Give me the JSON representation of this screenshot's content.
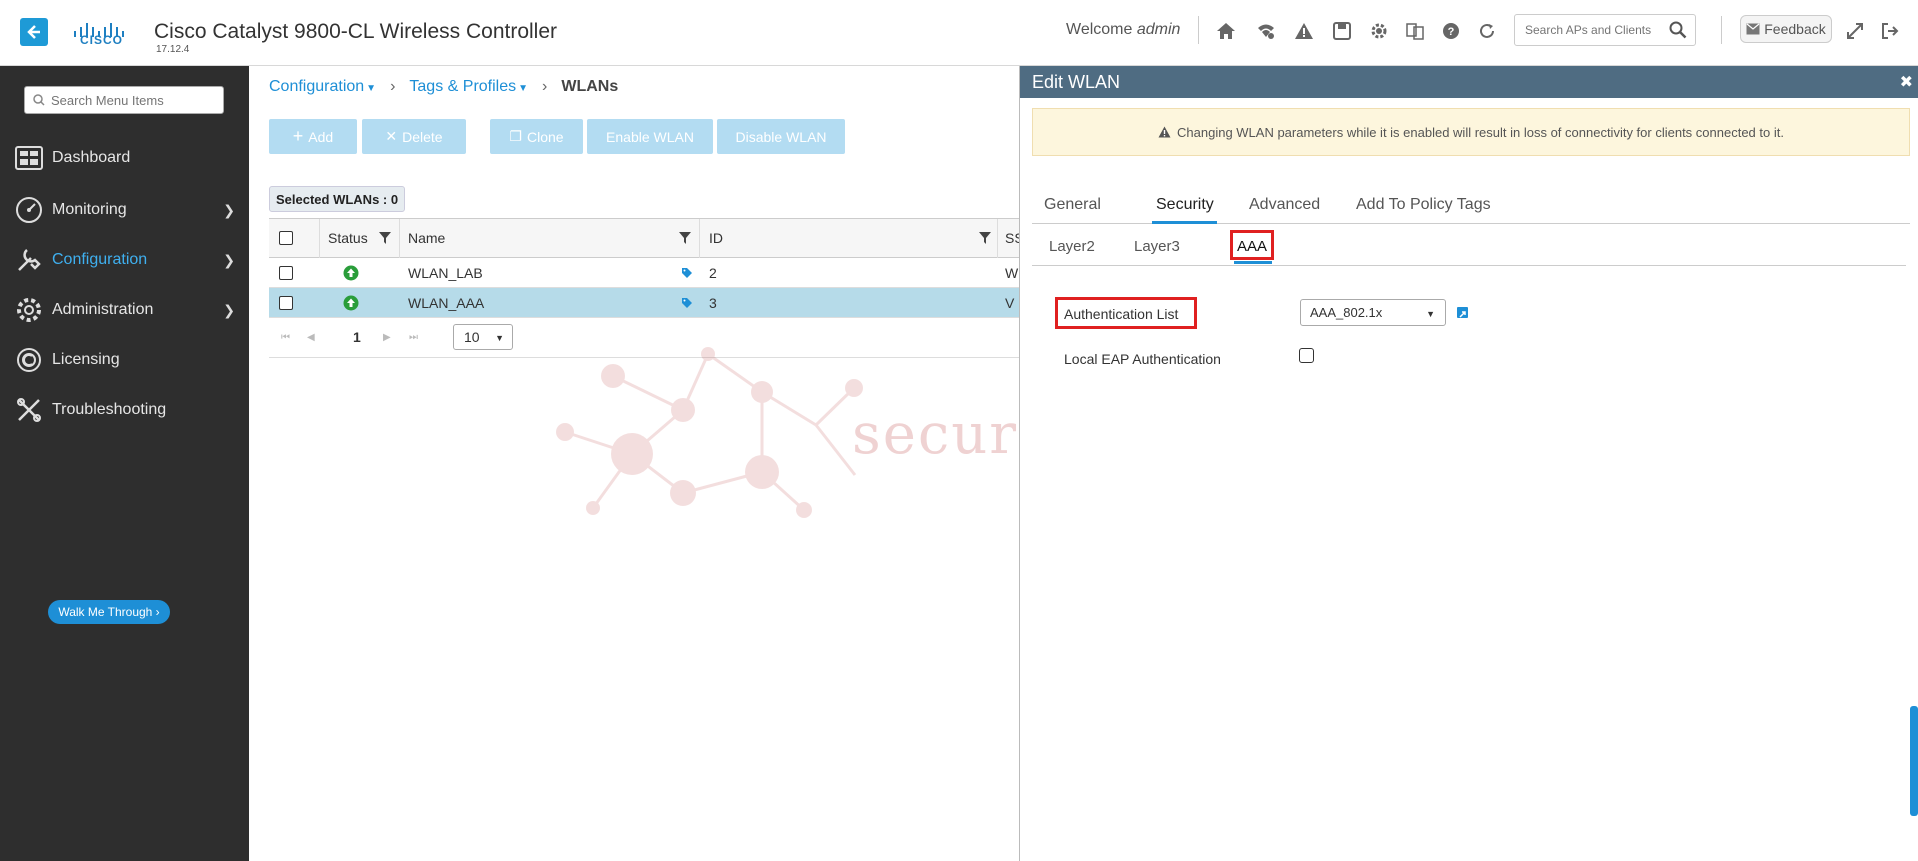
{
  "header": {
    "brand": "CISCO",
    "title": "Cisco Catalyst 9800-CL Wireless Controller",
    "version": "17.12.4",
    "welcome": "Welcome",
    "user": "admin",
    "search_placeholder": "Search APs and Clients",
    "feedback_label": "Feedback"
  },
  "sidebar": {
    "search_placeholder": "Search Menu Items",
    "items": [
      {
        "label": "Dashboard",
        "icon": "dashboard-icon"
      },
      {
        "label": "Monitoring",
        "icon": "monitoring-icon"
      },
      {
        "label": "Configuration",
        "icon": "configuration-icon"
      },
      {
        "label": "Administration",
        "icon": "administration-icon"
      },
      {
        "label": "Licensing",
        "icon": "licensing-icon"
      },
      {
        "label": "Troubleshooting",
        "icon": "troubleshooting-icon"
      }
    ],
    "active": "Configuration",
    "walk_me_label": "Walk Me Through ›"
  },
  "breadcrumb": {
    "level1": "Configuration",
    "level2": "Tags & Profiles",
    "current": "WLANs"
  },
  "toolbar": {
    "add": "Add",
    "delete": "Delete",
    "clone": "Clone",
    "enable": "Enable WLAN",
    "disable": "Disable WLAN"
  },
  "selected_label": "Selected WLANs : 0",
  "grid": {
    "columns": [
      "Status",
      "Name",
      "ID",
      "SS"
    ],
    "rows": [
      {
        "name": "WLAN_LAB",
        "id": "2",
        "ss": "W",
        "selected": false
      },
      {
        "name": "WLAN_AAA",
        "id": "3",
        "ss": "V",
        "selected": true
      }
    ],
    "page": "1",
    "page_size": "10"
  },
  "watermark": "securityzone.vn",
  "edit_panel": {
    "title": "Edit WLAN",
    "warning": "Changing WLAN parameters while it is enabled will result in loss of connectivity for clients connected to it.",
    "tabs": [
      "General",
      "Security",
      "Advanced",
      "Add To Policy Tags"
    ],
    "active_tab": "Security",
    "subtabs": [
      "Layer2",
      "Layer3",
      "AAA"
    ],
    "active_subtab": "AAA",
    "auth_list_label": "Authentication List",
    "auth_list_value": "AAA_802.1x",
    "local_eap_label": "Local EAP Authentication"
  },
  "colors": {
    "accent": "#1e8fd6",
    "sidebar_bg": "#2e2e2e",
    "panel_header": "#4f6c82",
    "highlight_red": "#e02020",
    "row_selected": "#b6dbe9"
  }
}
